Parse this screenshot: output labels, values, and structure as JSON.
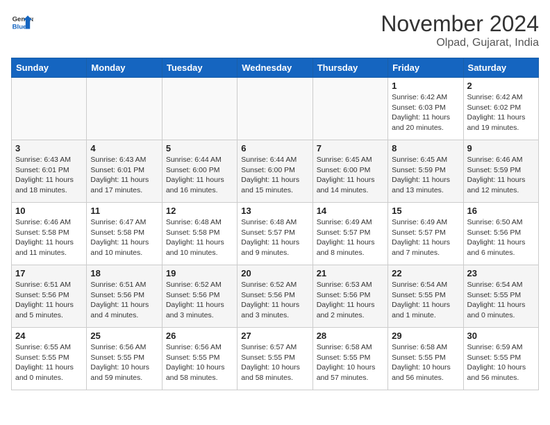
{
  "header": {
    "logo_line1": "General",
    "logo_line2": "Blue",
    "month": "November 2024",
    "location": "Olpad, Gujarat, India"
  },
  "weekdays": [
    "Sunday",
    "Monday",
    "Tuesday",
    "Wednesday",
    "Thursday",
    "Friday",
    "Saturday"
  ],
  "weeks": [
    [
      {
        "day": "",
        "info": ""
      },
      {
        "day": "",
        "info": ""
      },
      {
        "day": "",
        "info": ""
      },
      {
        "day": "",
        "info": ""
      },
      {
        "day": "",
        "info": ""
      },
      {
        "day": "1",
        "info": "Sunrise: 6:42 AM\nSunset: 6:03 PM\nDaylight: 11 hours and 20 minutes."
      },
      {
        "day": "2",
        "info": "Sunrise: 6:42 AM\nSunset: 6:02 PM\nDaylight: 11 hours and 19 minutes."
      }
    ],
    [
      {
        "day": "3",
        "info": "Sunrise: 6:43 AM\nSunset: 6:01 PM\nDaylight: 11 hours and 18 minutes."
      },
      {
        "day": "4",
        "info": "Sunrise: 6:43 AM\nSunset: 6:01 PM\nDaylight: 11 hours and 17 minutes."
      },
      {
        "day": "5",
        "info": "Sunrise: 6:44 AM\nSunset: 6:00 PM\nDaylight: 11 hours and 16 minutes."
      },
      {
        "day": "6",
        "info": "Sunrise: 6:44 AM\nSunset: 6:00 PM\nDaylight: 11 hours and 15 minutes."
      },
      {
        "day": "7",
        "info": "Sunrise: 6:45 AM\nSunset: 6:00 PM\nDaylight: 11 hours and 14 minutes."
      },
      {
        "day": "8",
        "info": "Sunrise: 6:45 AM\nSunset: 5:59 PM\nDaylight: 11 hours and 13 minutes."
      },
      {
        "day": "9",
        "info": "Sunrise: 6:46 AM\nSunset: 5:59 PM\nDaylight: 11 hours and 12 minutes."
      }
    ],
    [
      {
        "day": "10",
        "info": "Sunrise: 6:46 AM\nSunset: 5:58 PM\nDaylight: 11 hours and 11 minutes."
      },
      {
        "day": "11",
        "info": "Sunrise: 6:47 AM\nSunset: 5:58 PM\nDaylight: 11 hours and 10 minutes."
      },
      {
        "day": "12",
        "info": "Sunrise: 6:48 AM\nSunset: 5:58 PM\nDaylight: 11 hours and 10 minutes."
      },
      {
        "day": "13",
        "info": "Sunrise: 6:48 AM\nSunset: 5:57 PM\nDaylight: 11 hours and 9 minutes."
      },
      {
        "day": "14",
        "info": "Sunrise: 6:49 AM\nSunset: 5:57 PM\nDaylight: 11 hours and 8 minutes."
      },
      {
        "day": "15",
        "info": "Sunrise: 6:49 AM\nSunset: 5:57 PM\nDaylight: 11 hours and 7 minutes."
      },
      {
        "day": "16",
        "info": "Sunrise: 6:50 AM\nSunset: 5:56 PM\nDaylight: 11 hours and 6 minutes."
      }
    ],
    [
      {
        "day": "17",
        "info": "Sunrise: 6:51 AM\nSunset: 5:56 PM\nDaylight: 11 hours and 5 minutes."
      },
      {
        "day": "18",
        "info": "Sunrise: 6:51 AM\nSunset: 5:56 PM\nDaylight: 11 hours and 4 minutes."
      },
      {
        "day": "19",
        "info": "Sunrise: 6:52 AM\nSunset: 5:56 PM\nDaylight: 11 hours and 3 minutes."
      },
      {
        "day": "20",
        "info": "Sunrise: 6:52 AM\nSunset: 5:56 PM\nDaylight: 11 hours and 3 minutes."
      },
      {
        "day": "21",
        "info": "Sunrise: 6:53 AM\nSunset: 5:56 PM\nDaylight: 11 hours and 2 minutes."
      },
      {
        "day": "22",
        "info": "Sunrise: 6:54 AM\nSunset: 5:55 PM\nDaylight: 11 hours and 1 minute."
      },
      {
        "day": "23",
        "info": "Sunrise: 6:54 AM\nSunset: 5:55 PM\nDaylight: 11 hours and 0 minutes."
      }
    ],
    [
      {
        "day": "24",
        "info": "Sunrise: 6:55 AM\nSunset: 5:55 PM\nDaylight: 11 hours and 0 minutes."
      },
      {
        "day": "25",
        "info": "Sunrise: 6:56 AM\nSunset: 5:55 PM\nDaylight: 10 hours and 59 minutes."
      },
      {
        "day": "26",
        "info": "Sunrise: 6:56 AM\nSunset: 5:55 PM\nDaylight: 10 hours and 58 minutes."
      },
      {
        "day": "27",
        "info": "Sunrise: 6:57 AM\nSunset: 5:55 PM\nDaylight: 10 hours and 58 minutes."
      },
      {
        "day": "28",
        "info": "Sunrise: 6:58 AM\nSunset: 5:55 PM\nDaylight: 10 hours and 57 minutes."
      },
      {
        "day": "29",
        "info": "Sunrise: 6:58 AM\nSunset: 5:55 PM\nDaylight: 10 hours and 56 minutes."
      },
      {
        "day": "30",
        "info": "Sunrise: 6:59 AM\nSunset: 5:55 PM\nDaylight: 10 hours and 56 minutes."
      }
    ]
  ]
}
